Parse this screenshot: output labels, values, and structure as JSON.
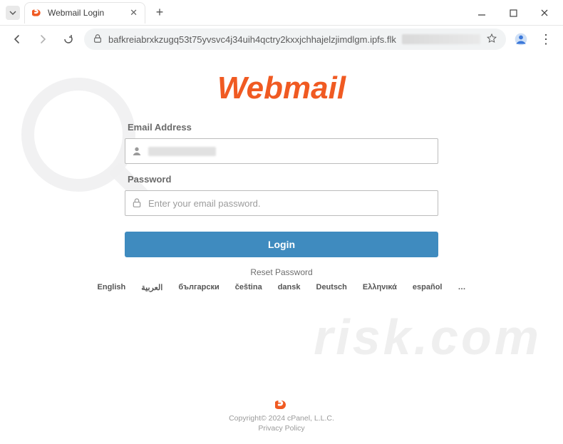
{
  "window": {
    "tab_title": "Webmail Login",
    "url": "bafkreiabrxkzugq53t75yvsvc4j34uih4qctry2kxxjchhajelzjimdlgm.ipfs.flk-ipfs.xyz/#"
  },
  "page": {
    "logo_text": "Webmail",
    "email_label": "Email Address",
    "password_label": "Password",
    "password_placeholder": "Enter your email password.",
    "login_button": "Login",
    "reset_link": "Reset Password",
    "languages": [
      "English",
      "العربية",
      "български",
      "čeština",
      "dansk",
      "Deutsch",
      "Ελληνικά",
      "español",
      "…"
    ],
    "watermark_text": "risk.com"
  },
  "footer": {
    "copyright": "Copyright© 2024 cPanel, L.L.C.",
    "privacy": "Privacy Policy"
  }
}
